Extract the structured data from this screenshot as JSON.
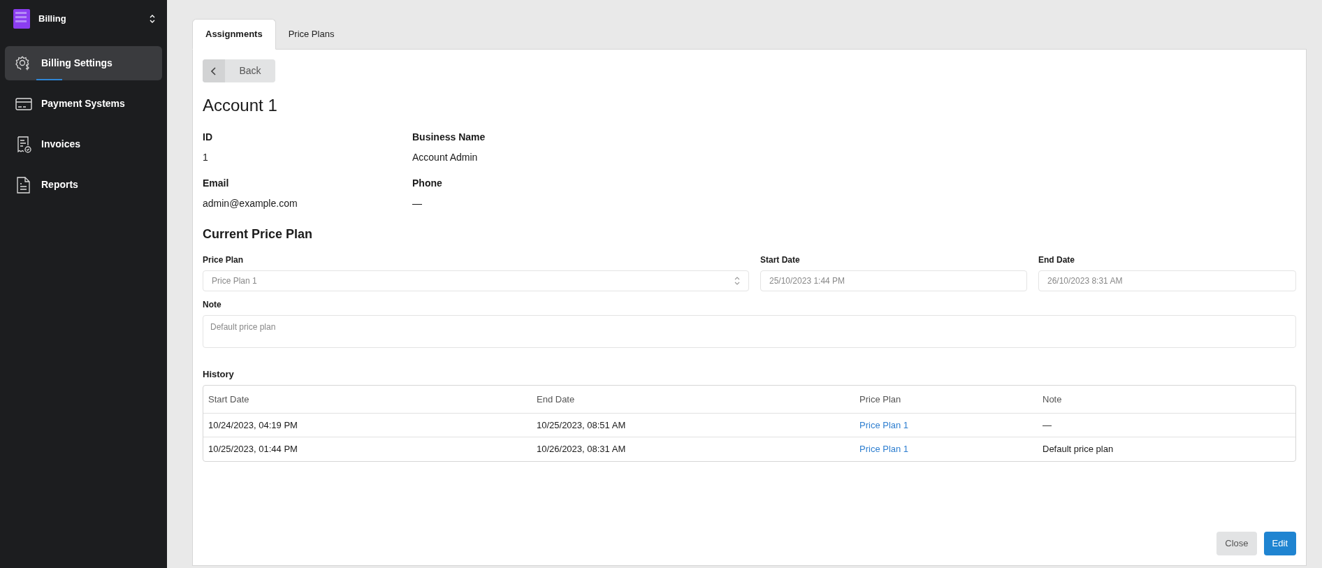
{
  "sidebar": {
    "app_title": "Billing",
    "items": [
      {
        "label": "Billing Settings",
        "kind": "settings",
        "selected": true
      },
      {
        "label": "Payment Systems",
        "kind": "payments",
        "selected": false
      },
      {
        "label": "Invoices",
        "kind": "invoices",
        "selected": false
      },
      {
        "label": "Reports",
        "kind": "reports",
        "selected": false
      }
    ]
  },
  "tabs": [
    {
      "label": "Assignments",
      "selected": true
    },
    {
      "label": "Price Plans",
      "selected": false
    }
  ],
  "back_button": "Back",
  "title": "Account 1",
  "details": [
    {
      "label": "ID",
      "value": "1"
    },
    {
      "label": "Business Name",
      "value": "Account Admin"
    },
    {
      "label": "Email",
      "value": "admin@example.com"
    },
    {
      "label": "Phone",
      "value": "—"
    }
  ],
  "current_plan": {
    "heading": "Current Price Plan",
    "fields": [
      {
        "label": "Price Plan",
        "value": "Price Plan 1",
        "kind": "select",
        "disabled": true
      },
      {
        "label": "Start Date",
        "value": "25/10/2023 1:44 PM",
        "kind": "date",
        "disabled": true
      },
      {
        "label": "End Date",
        "value": "26/10/2023 8:31 AM",
        "kind": "date",
        "disabled": true
      }
    ],
    "note": {
      "label": "Note",
      "value": "Default price plan",
      "disabled": true
    }
  },
  "history": {
    "label": "History",
    "columns": [
      {
        "label": "Start Date",
        "kind": "text"
      },
      {
        "label": "End Date",
        "kind": "text"
      },
      {
        "label": "Price Plan",
        "kind": "link"
      },
      {
        "label": "Note",
        "kind": "text"
      }
    ],
    "rows": [
      [
        "10/24/2023, 04:19 PM",
        "10/25/2023, 08:51 AM",
        "Price Plan 1",
        "—"
      ],
      [
        "10/25/2023, 01:44 PM",
        "10/26/2023, 08:31 AM",
        "Price Plan 1",
        "Default price plan"
      ]
    ]
  },
  "buttons": [
    {
      "label": "Close",
      "kind": "secondary"
    },
    {
      "label": "Edit",
      "kind": "primary"
    }
  ]
}
